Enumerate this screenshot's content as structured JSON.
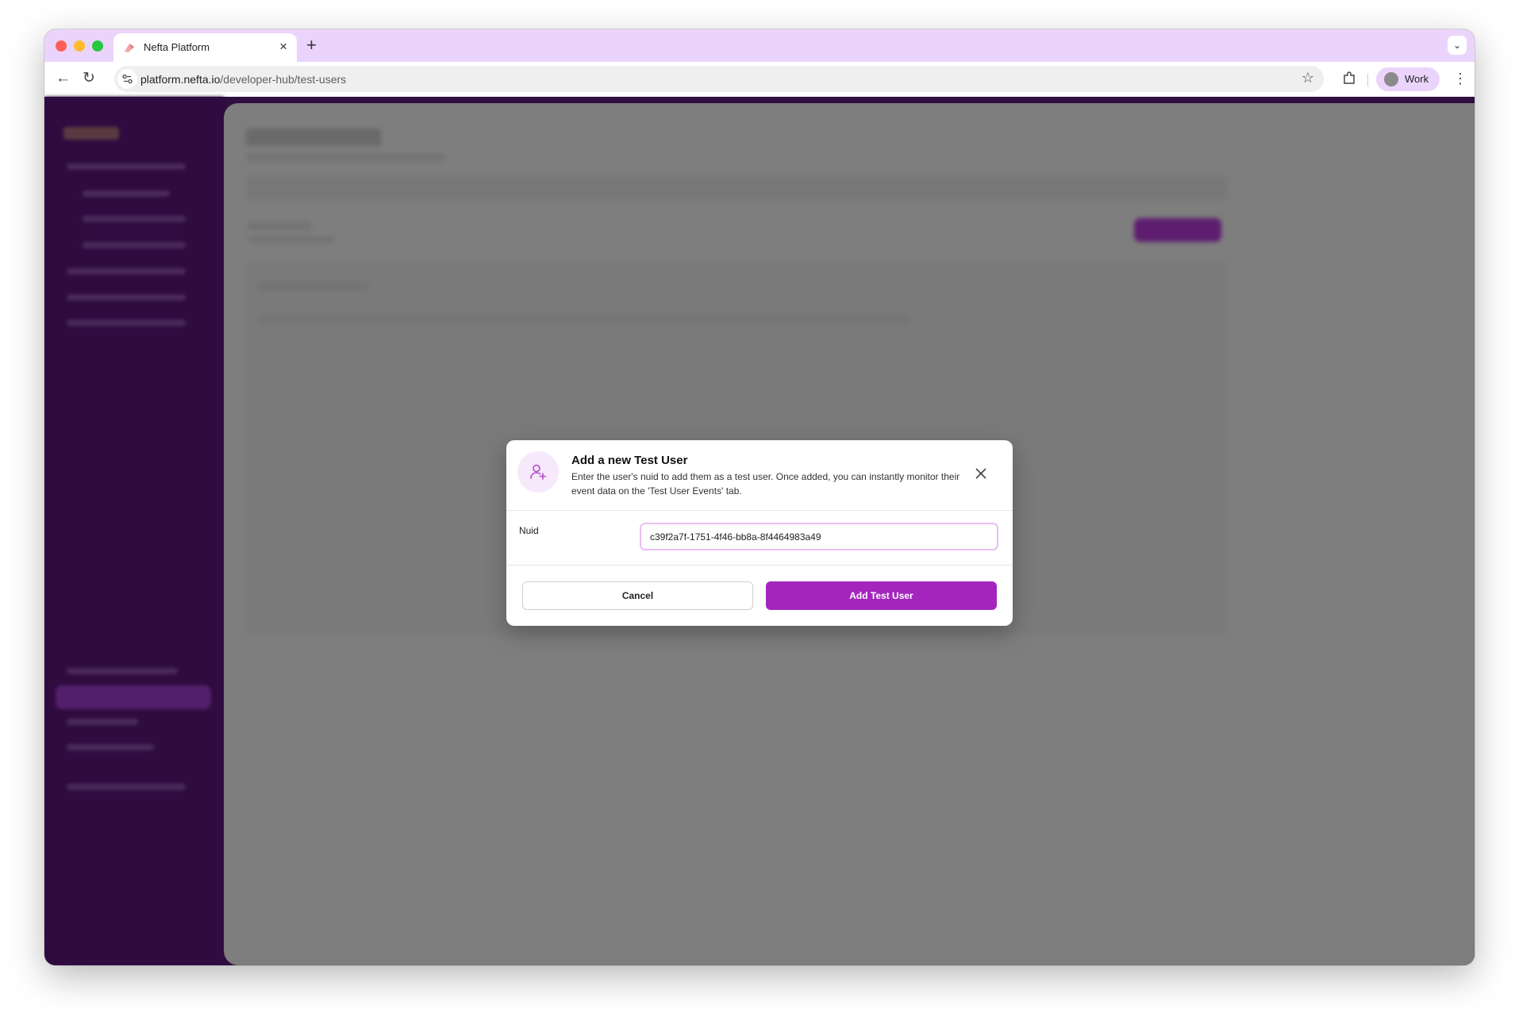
{
  "browser": {
    "tab_title": "Nefta Platform",
    "new_tab_symbol": "+",
    "url_host": "platform.nefta.io",
    "url_path": "/developer-hub/test-users",
    "profile_label": "Work"
  },
  "modal": {
    "title": "Add a new Test User",
    "description": "Enter the user's nuid to add them as a test user. Once added, you can instantly monitor their event data on the 'Test User Events' tab.",
    "field_label": "Nuid",
    "field_value": "c39f2a7f-1751-4f46-bb8a-8f4464983a49",
    "cancel_label": "Cancel",
    "submit_label": "Add Test User",
    "icon": "user-plus-icon"
  },
  "colors": {
    "accent": "#a425be",
    "sidebar": "#2f0b40",
    "tabstrip": "#ebd4fb",
    "overlay": "#7f7f7f"
  }
}
